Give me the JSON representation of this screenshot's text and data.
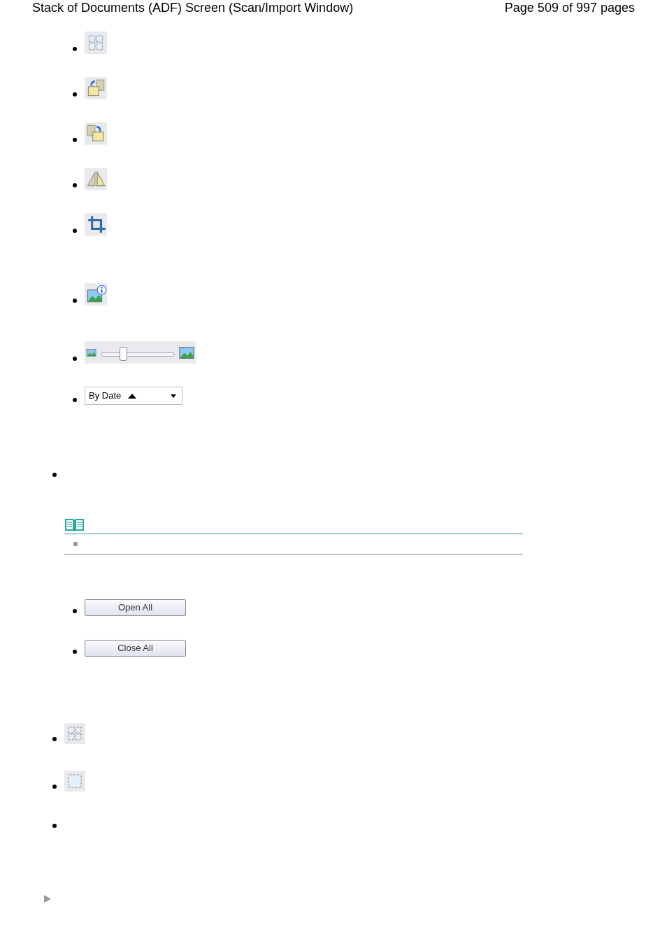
{
  "header": {
    "title": "Stack of Documents (ADF) Screen (Scan/Import Window)",
    "page": "Page 509 of 997 pages"
  },
  "tool_icons": [
    {
      "kind": "grid"
    },
    {
      "kind": "swap-left"
    },
    {
      "kind": "swap-right"
    },
    {
      "kind": "mirror"
    },
    {
      "kind": "crop"
    },
    {
      "kind": "info"
    }
  ],
  "zoom_slider": {
    "level": 0.3
  },
  "sort_dropdown": {
    "value": "By Date",
    "ascending": true
  },
  "buttons": [
    "Open All",
    "Close All"
  ],
  "selection_icons": [
    {
      "kind": "grid"
    },
    {
      "kind": "single"
    }
  ]
}
